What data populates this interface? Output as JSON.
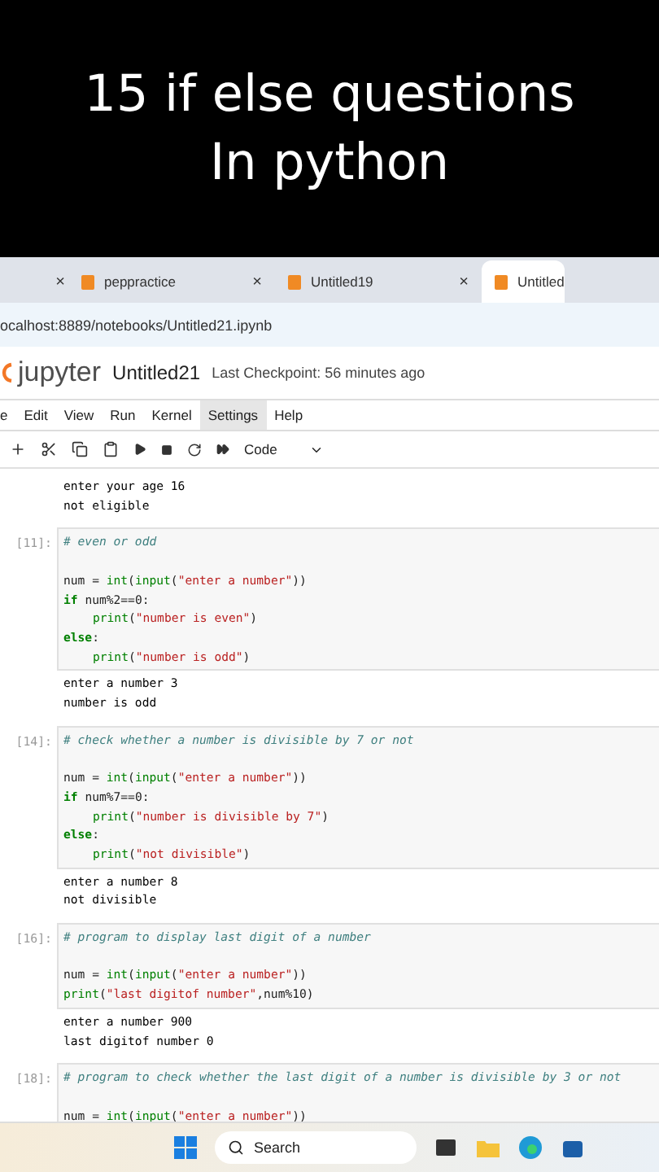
{
  "banner": {
    "lines": [
      "15 if else questions",
      "In python"
    ]
  },
  "browser": {
    "tabs": [
      {
        "selected": false
      },
      {
        "label": "peppractice",
        "selected": false
      },
      {
        "label": "Untitled19",
        "selected": false
      },
      {
        "label": "Untitled",
        "selected": true
      }
    ],
    "close_glyph": "×",
    "url": "ocalhost:8889/notebooks/Untitled21.ipynb"
  },
  "jupyter": {
    "logo": "jupyter",
    "notebook": "Untitled21",
    "checkpoint": "Last Checkpoint: 56 minutes ago",
    "menu": [
      {
        "label": "e",
        "selected": false
      },
      {
        "label": "Edit",
        "selected": false
      },
      {
        "label": "View",
        "selected": false
      },
      {
        "label": "Run",
        "selected": false
      },
      {
        "label": "Kernel",
        "selected": false
      },
      {
        "label": "Settings",
        "selected": true
      },
      {
        "label": "Help",
        "selected": false
      }
    ],
    "cell_type": "Code"
  },
  "cells": [
    {
      "output": [
        "enter your age 16",
        "not eligible"
      ]
    },
    {
      "prompt": "[11]:",
      "code": [
        {
          "kind": "code",
          "segments": [
            {
              "kind": "comment",
              "text": "# even or odd"
            }
          ]
        },
        {
          "kind": "blank"
        },
        {
          "kind": "code",
          "segments": [
            {
              "kind": "plain",
              "text": "num = "
            },
            {
              "kind": "builtin",
              "text": "int"
            },
            {
              "kind": "plain",
              "text": "("
            },
            {
              "kind": "builtin",
              "text": "input"
            },
            {
              "kind": "plain",
              "text": "("
            },
            {
              "kind": "string",
              "text": "\"enter a number\""
            },
            {
              "kind": "plain",
              "text": "))"
            }
          ]
        },
        {
          "kind": "code",
          "segments": [
            {
              "kind": "keyword",
              "text": "if"
            },
            {
              "kind": "plain",
              "text": " num%2==0:"
            }
          ]
        },
        {
          "kind": "code",
          "indent": true,
          "segments": [
            {
              "kind": "builtin",
              "text": "print"
            },
            {
              "kind": "plain",
              "text": "("
            },
            {
              "kind": "string",
              "text": "\"number is even\""
            },
            {
              "kind": "plain",
              "text": ")"
            }
          ]
        },
        {
          "kind": "code",
          "segments": [
            {
              "kind": "keyword",
              "text": "else"
            },
            {
              "kind": "plain",
              "text": ":"
            }
          ]
        },
        {
          "kind": "code",
          "indent": true,
          "segments": [
            {
              "kind": "builtin",
              "text": "print"
            },
            {
              "kind": "plain",
              "text": "("
            },
            {
              "kind": "string",
              "text": "\"number is odd\""
            },
            {
              "kind": "plain",
              "text": ")"
            }
          ]
        }
      ],
      "output": [
        "enter a number 3",
        "number is odd"
      ]
    },
    {
      "prompt": "[14]:",
      "code": [
        {
          "kind": "code",
          "segments": [
            {
              "kind": "comment",
              "text": "# check whether a number is divisible by 7 or not"
            }
          ]
        },
        {
          "kind": "blank"
        },
        {
          "kind": "code",
          "segments": [
            {
              "kind": "plain",
              "text": "num = "
            },
            {
              "kind": "builtin",
              "text": "int"
            },
            {
              "kind": "plain",
              "text": "("
            },
            {
              "kind": "builtin",
              "text": "input"
            },
            {
              "kind": "plain",
              "text": "("
            },
            {
              "kind": "string",
              "text": "\"enter a number\""
            },
            {
              "kind": "plain",
              "text": "))"
            }
          ]
        },
        {
          "kind": "code",
          "segments": [
            {
              "kind": "keyword",
              "text": "if"
            },
            {
              "kind": "plain",
              "text": " num%7==0:"
            }
          ]
        },
        {
          "kind": "code",
          "indent": true,
          "segments": [
            {
              "kind": "builtin",
              "text": "print"
            },
            {
              "kind": "plain",
              "text": "("
            },
            {
              "kind": "string",
              "text": "\"number is divisible by 7\""
            },
            {
              "kind": "plain",
              "text": ")"
            }
          ]
        },
        {
          "kind": "code",
          "segments": [
            {
              "kind": "keyword",
              "text": "else"
            },
            {
              "kind": "plain",
              "text": ":"
            }
          ]
        },
        {
          "kind": "code",
          "indent": true,
          "segments": [
            {
              "kind": "builtin",
              "text": "print"
            },
            {
              "kind": "plain",
              "text": "("
            },
            {
              "kind": "string",
              "text": "\"not divisible\""
            },
            {
              "kind": "plain",
              "text": ")"
            }
          ]
        }
      ],
      "output": [
        "enter a number 8",
        "not divisible"
      ]
    },
    {
      "prompt": "[16]:",
      "code": [
        {
          "kind": "code",
          "segments": [
            {
              "kind": "comment",
              "text": "# program to display last digit of a number"
            }
          ]
        },
        {
          "kind": "blank"
        },
        {
          "kind": "code",
          "segments": [
            {
              "kind": "plain",
              "text": "num = "
            },
            {
              "kind": "builtin",
              "text": "int"
            },
            {
              "kind": "plain",
              "text": "("
            },
            {
              "kind": "builtin",
              "text": "input"
            },
            {
              "kind": "plain",
              "text": "("
            },
            {
              "kind": "string",
              "text": "\"enter a number\""
            },
            {
              "kind": "plain",
              "text": "))"
            }
          ]
        },
        {
          "kind": "code",
          "segments": [
            {
              "kind": "builtin",
              "text": "print"
            },
            {
              "kind": "plain",
              "text": "("
            },
            {
              "kind": "string",
              "text": "\"last digitof number\""
            },
            {
              "kind": "plain",
              "text": ",num%10)"
            }
          ]
        }
      ],
      "output": [
        "enter a number 900",
        "last digitof number 0"
      ]
    },
    {
      "prompt": "[18]:",
      "code": [
        {
          "kind": "code",
          "segments": [
            {
              "kind": "comment",
              "text": "# program to check whether the last digit of a number is divisible by 3 or not"
            }
          ]
        },
        {
          "kind": "blank"
        },
        {
          "kind": "code",
          "segments": [
            {
              "kind": "plain",
              "text": "num = "
            },
            {
              "kind": "builtin",
              "text": "int"
            },
            {
              "kind": "plain",
              "text": "("
            },
            {
              "kind": "builtin",
              "text": "input"
            },
            {
              "kind": "plain",
              "text": "("
            },
            {
              "kind": "string",
              "text": "\"enter a number\""
            },
            {
              "kind": "plain",
              "text": "))"
            }
          ]
        }
      ]
    }
  ],
  "taskbar": {
    "search": "Search"
  }
}
